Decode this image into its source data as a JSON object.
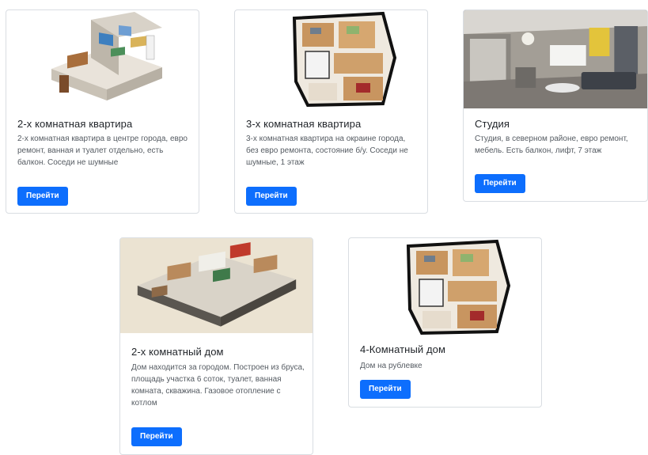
{
  "cards": [
    {
      "title": "2-х комнатная квартира",
      "text": "2-х комнатная квартира в центре города, евро ремонт, ванная и туалет отдельно, есть балкон. Соседи не шумные",
      "button": "Перейти",
      "image_icon": "apartment-3d-plan"
    },
    {
      "title": "3-х комнатная квартира",
      "text": "3-х комнатная квартира на окраине города, без евро ремонта, состояние б/у. Соседи не шумные, 1 этаж",
      "button": "Перейти",
      "image_icon": "floor-plan-topdown"
    },
    {
      "title": "Студия",
      "text": "Студия, в северном районе, евро ремонт, мебель. Есть балкон, лифт, 7 этаж",
      "button": "Перейти",
      "image_icon": "living-room-photo"
    },
    {
      "title": "2-х комнатный дом",
      "text": "Дом находится за городом. Построен из бруса, площадь участка 6 соток, туалет, ванная комната, скважина. Газовое отопление с котлом",
      "button": "Перейти",
      "image_icon": "house-3d-plan"
    },
    {
      "title": "4-Комнатный дом",
      "text": "Дом на рублевке",
      "button": "Перейти",
      "image_icon": "floor-plan-topdown"
    }
  ],
  "colors": {
    "primary": "#0d6efd",
    "card_border": "#d9dde2",
    "text_muted": "#555b62"
  }
}
